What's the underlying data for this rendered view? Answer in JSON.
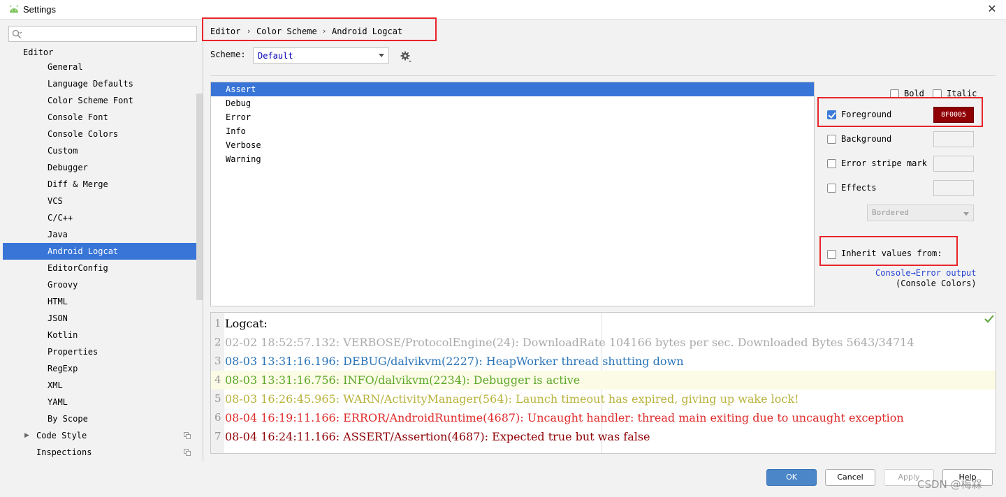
{
  "window": {
    "title": "Settings",
    "close_glyph": "✕"
  },
  "search": {
    "placeholder": ""
  },
  "sidebar": {
    "header": "Editor",
    "items": [
      {
        "label": "General",
        "level": 2,
        "selected": false
      },
      {
        "label": "Language Defaults",
        "level": 2,
        "selected": false
      },
      {
        "label": "Color Scheme Font",
        "level": 2,
        "selected": false
      },
      {
        "label": "Console Font",
        "level": 2,
        "selected": false
      },
      {
        "label": "Console Colors",
        "level": 2,
        "selected": false
      },
      {
        "label": "Custom",
        "level": 2,
        "selected": false
      },
      {
        "label": "Debugger",
        "level": 2,
        "selected": false
      },
      {
        "label": "Diff & Merge",
        "level": 2,
        "selected": false
      },
      {
        "label": "VCS",
        "level": 2,
        "selected": false
      },
      {
        "label": "C/C++",
        "level": 2,
        "selected": false
      },
      {
        "label": "Java",
        "level": 2,
        "selected": false
      },
      {
        "label": "Android Logcat",
        "level": 2,
        "selected": true
      },
      {
        "label": "EditorConfig",
        "level": 2,
        "selected": false
      },
      {
        "label": "Groovy",
        "level": 2,
        "selected": false
      },
      {
        "label": "HTML",
        "level": 2,
        "selected": false
      },
      {
        "label": "JSON",
        "level": 2,
        "selected": false
      },
      {
        "label": "Kotlin",
        "level": 2,
        "selected": false
      },
      {
        "label": "Properties",
        "level": 2,
        "selected": false
      },
      {
        "label": "RegExp",
        "level": 2,
        "selected": false
      },
      {
        "label": "XML",
        "level": 2,
        "selected": false
      },
      {
        "label": "YAML",
        "level": 2,
        "selected": false
      },
      {
        "label": "By Scope",
        "level": 2,
        "selected": false
      },
      {
        "label": "Code Style",
        "level": 1,
        "selected": false,
        "expandable": true,
        "icon": "copy-icon"
      },
      {
        "label": "Inspections",
        "level": 1,
        "selected": false,
        "icon": "copy-icon"
      }
    ]
  },
  "breadcrumb": [
    "Editor",
    "Color Scheme",
    "Android Logcat"
  ],
  "breadcrumb_sep": "›",
  "scheme": {
    "label": "Scheme:",
    "value": "Default"
  },
  "log_levels": {
    "items": [
      "Assert",
      "Debug",
      "Error",
      "Info",
      "Verbose",
      "Warning"
    ],
    "selected": "Assert"
  },
  "attributes": {
    "bold": {
      "label": "Bold",
      "checked": false
    },
    "italic": {
      "label": "Italic",
      "checked": false
    },
    "foreground": {
      "label": "Foreground",
      "checked": true,
      "color_text": "8F0005",
      "color": "#8f0005"
    },
    "background": {
      "label": "Background",
      "checked": false
    },
    "error_stripe": {
      "label": "Error stripe mark",
      "checked": false
    },
    "effects": {
      "label": "Effects",
      "checked": false,
      "style": "Bordered"
    },
    "inherit": {
      "label": "Inherit values from:",
      "checked": false,
      "link": "Console→Error output",
      "note": "(Console Colors)"
    }
  },
  "preview": {
    "lines": [
      {
        "n": "1",
        "text": "Logcat:",
        "color": "#000000"
      },
      {
        "n": "2",
        "text": "02-02 18:52:57.132: VERBOSE/ProtocolEngine(24): DownloadRate 104166 bytes per sec. Downloaded Bytes 5643/34714",
        "color": "#aaaaaa"
      },
      {
        "n": "3",
        "text": "08-03 13:31:16.196: DEBUG/dalvikvm(2227): HeapWorker thread shutting down",
        "color": "#2a74b8"
      },
      {
        "n": "4",
        "text": "08-03 13:31:16.756: INFO/dalvikvm(2234): Debugger is active",
        "color": "#5ea82a",
        "highlight": true
      },
      {
        "n": "5",
        "text": "08-03 16:26:45.965: WARN/ActivityManager(564): Launch timeout has expired, giving up wake lock!",
        "color": "#b8b23c"
      },
      {
        "n": "6",
        "text": "08-04 16:19:11.166: ERROR/AndroidRuntime(4687): Uncaught handler: thread main exiting due to uncaught exception",
        "color": "#e02a2a"
      },
      {
        "n": "7",
        "text": "08-04 16:24:11.166: ASSERT/Assertion(4687): Expected true but was false",
        "color": "#8f0005"
      }
    ]
  },
  "buttons": {
    "ok": "OK",
    "cancel": "Cancel",
    "apply": "Apply",
    "help": "Help"
  },
  "watermark": "CSDN @梅槑"
}
